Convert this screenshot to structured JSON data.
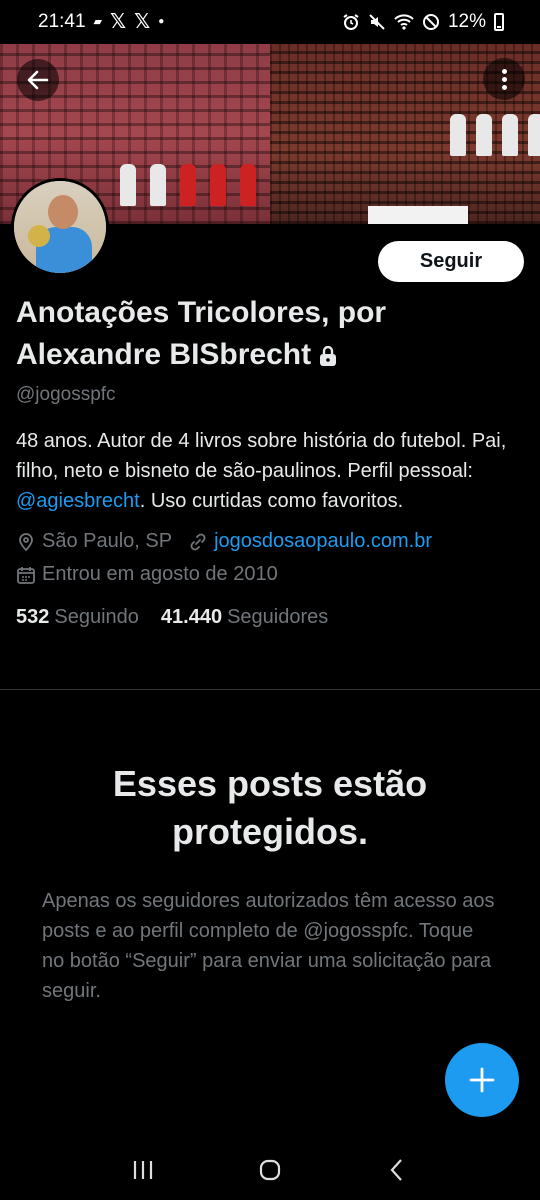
{
  "status_bar": {
    "time": "21:41",
    "battery": "12%"
  },
  "profile": {
    "display_name_line1": "Anotações Tricolores, por",
    "display_name_line2": "Alexandre BISbrecht",
    "handle": "@jogosspfc",
    "bio_part1": "48 anos. Autor de 4 livros sobre história do futebol. Pai, filho, neto e bisneto de são-paulinos. Perfil pessoal: ",
    "bio_mention": "@agiesbrecht",
    "bio_part2": ". Uso curtidas como favoritos.",
    "location": "São Paulo, SP",
    "website": "jogosdosaopaulo.com.br",
    "joined": "Entrou em agosto de 2010",
    "following_count": "532",
    "following_label": "Seguindo",
    "followers_count": "41.440",
    "followers_label": "Seguidores"
  },
  "actions": {
    "follow_label": "Seguir"
  },
  "protected": {
    "title": "Esses posts estão protegidos.",
    "text": "Apenas os seguidores autorizados têm acesso aos posts e ao perfil completo de @jogosspfc. Toque no botão “Seguir” para enviar uma solicitação para seguir."
  },
  "colors": {
    "accent": "#1d9bf0",
    "background": "#000000",
    "secondary_text": "#71767b"
  },
  "icons": [
    "arrow-left-icon",
    "more-vertical-icon",
    "lock-icon",
    "location-pin-icon",
    "link-icon",
    "calendar-icon",
    "plus-icon"
  ]
}
